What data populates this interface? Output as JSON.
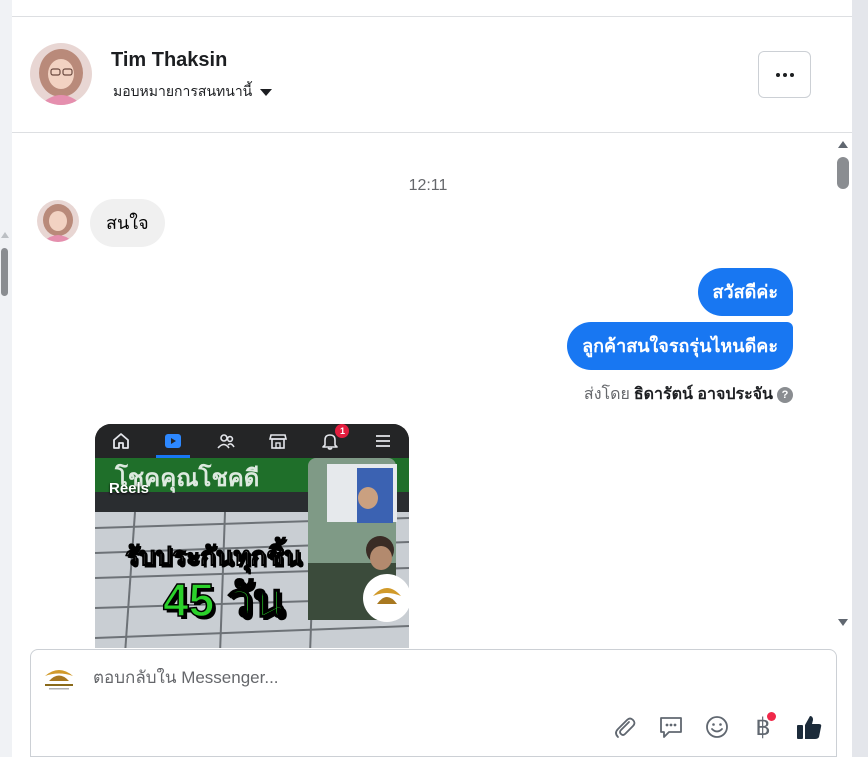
{
  "header": {
    "contact_name": "Tim Thaksin",
    "assign_label": "มอบหมายการสนทนานี้",
    "more_label": "..."
  },
  "thread": {
    "timestamp": "12:11",
    "incoming": [
      {
        "text": "สนใจ"
      }
    ],
    "outgoing": [
      {
        "text": "สวัสดีค่ะ"
      },
      {
        "text": "ลูกค้าสนใจรถรุ่นไหนดีคะ"
      }
    ],
    "sent_by_prefix": "ส่งโดย",
    "sent_by_name": "ธิดารัตน์ อาจประจัน",
    "help_glyph": "?"
  },
  "reel": {
    "label": "Reels",
    "banner_text": "โชคคุณโชคดี",
    "promo_line1": "รับประกันทุกชิ้น",
    "promo_line2": "45 วัน",
    "notification_count": "1",
    "nav_icons": [
      "home-icon",
      "reels-icon",
      "friends-icon",
      "marketplace-icon",
      "bell-icon",
      "menu-icon"
    ]
  },
  "composer": {
    "placeholder": "ตอบกลับใน Messenger...",
    "value": "",
    "tools": [
      "attachment-icon",
      "saved-reply-icon",
      "emoji-icon",
      "payment-icon",
      "like-icon"
    ],
    "payment_glyph": "฿"
  },
  "colors": {
    "accent": "#1877f2",
    "bubble_in": "#f0f0f0",
    "notification": "#e41e3f",
    "promo_green": "#2bd12b"
  }
}
